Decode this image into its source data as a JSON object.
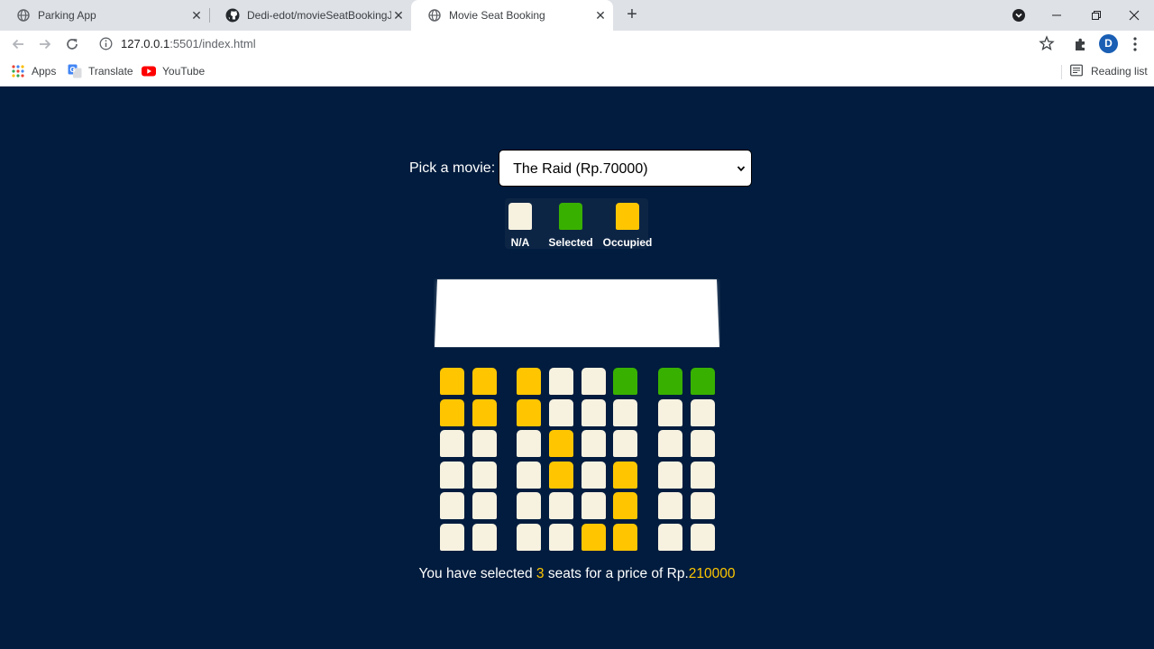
{
  "browser": {
    "tabs": [
      {
        "title": "Parking App",
        "icon": "globe-icon",
        "active": false
      },
      {
        "title": "Dedi-edot/movieSeatBookingJS",
        "icon": "github-icon",
        "active": false
      },
      {
        "title": "Movie Seat Booking",
        "icon": "globe-icon",
        "active": true
      }
    ],
    "url_host": "127.0.0.1",
    "url_rest": ":5501/index.html",
    "profile_initial": "D",
    "bookmarks": [
      {
        "label": "Apps",
        "icon": "apps-grid-icon"
      },
      {
        "label": "Translate",
        "icon": "translate-icon"
      },
      {
        "label": "YouTube",
        "icon": "youtube-icon"
      }
    ],
    "reading_list": "Reading list"
  },
  "page": {
    "picker_label": "Pick a movie:",
    "selected_movie": "The Raid (Rp.70000)",
    "legend": [
      {
        "label": "N/A",
        "status": "na"
      },
      {
        "label": "Selected",
        "status": "selected"
      },
      {
        "label": "Occupied",
        "status": "occupied"
      }
    ],
    "colors": {
      "background": "#011c3e",
      "na": "#f7f1e0",
      "selected": "#38b000",
      "occupied": "#ffc600"
    },
    "seat_rows": [
      [
        "occupied",
        "occupied",
        "occupied",
        "na",
        "na",
        "selected",
        "selected",
        "selected"
      ],
      [
        "occupied",
        "occupied",
        "occupied",
        "na",
        "na",
        "na",
        "na",
        "na"
      ],
      [
        "na",
        "na",
        "na",
        "occupied",
        "na",
        "na",
        "na",
        "na"
      ],
      [
        "na",
        "na",
        "na",
        "occupied",
        "na",
        "occupied",
        "na",
        "na"
      ],
      [
        "na",
        "na",
        "na",
        "na",
        "na",
        "occupied",
        "na",
        "na"
      ],
      [
        "na",
        "na",
        "na",
        "na",
        "occupied",
        "occupied",
        "na",
        "na"
      ]
    ],
    "summary": {
      "prefix": "You have selected ",
      "count": "3",
      "middle": " seats for a price of Rp.",
      "total": "210000"
    }
  }
}
